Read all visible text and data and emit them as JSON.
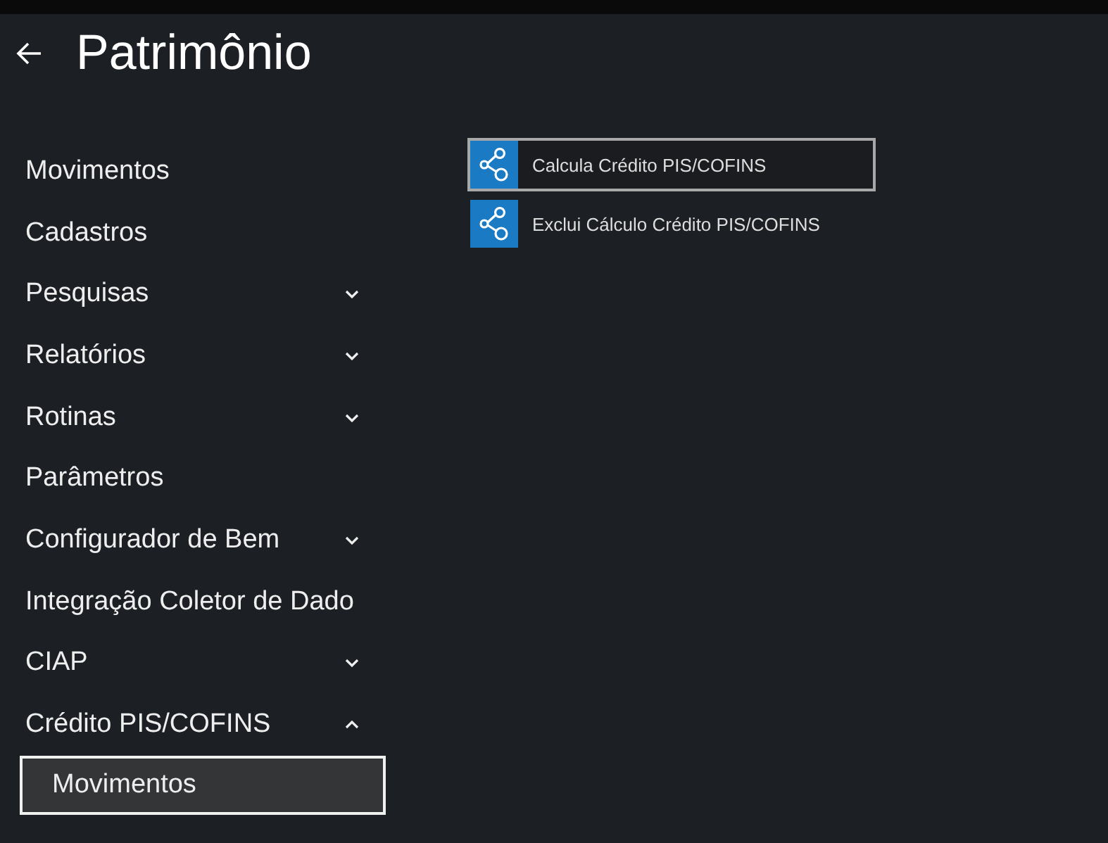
{
  "header": {
    "title": "Patrimônio"
  },
  "nav": [
    {
      "label": "Movimentos",
      "kind": "link",
      "selected": false
    },
    {
      "label": "Cadastros",
      "kind": "link",
      "selected": false
    },
    {
      "label": "Pesquisas",
      "kind": "group",
      "expanded": false
    },
    {
      "label": "Relatórios",
      "kind": "group",
      "expanded": false
    },
    {
      "label": "Rotinas",
      "kind": "group",
      "expanded": false
    },
    {
      "label": "Parâmetros",
      "kind": "link",
      "selected": false
    },
    {
      "label": "Configurador de Bem",
      "kind": "group",
      "expanded": false
    },
    {
      "label": "Integração Coletor de Dado",
      "kind": "link",
      "selected": false
    },
    {
      "label": "CIAP",
      "kind": "group",
      "expanded": false
    },
    {
      "label": "Crédito PIS/COFINS",
      "kind": "group",
      "expanded": true,
      "children": [
        {
          "label": "Movimentos",
          "kind": "link",
          "selected": true
        }
      ]
    }
  ],
  "actions": [
    {
      "label": "Calcula Crédito PIS/COFINS",
      "selected": true
    },
    {
      "label": "Exclui Cálculo Crédito PIS/COFINS",
      "selected": false
    }
  ]
}
